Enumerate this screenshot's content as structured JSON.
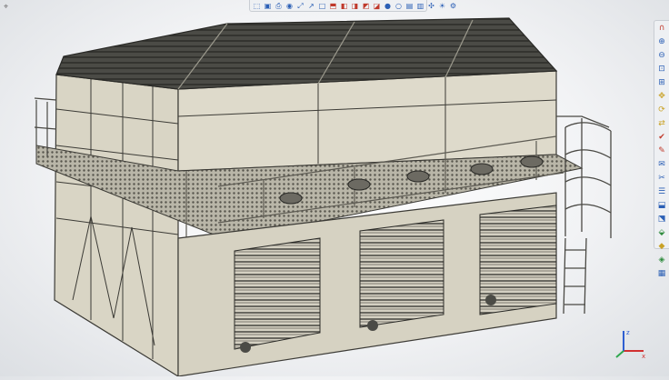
{
  "viewer": {
    "model": "evaporative-cooling-tower-3-cell"
  },
  "top_toolbar": {
    "buttons": [
      {
        "icon": "select-icon",
        "glyph": "⬚"
      },
      {
        "icon": "save-view-icon",
        "glyph": "▣"
      },
      {
        "icon": "print-icon",
        "glyph": "⎙"
      },
      {
        "icon": "camera-icon",
        "glyph": "◉"
      },
      {
        "icon": "fit-view-icon",
        "glyph": "⤢"
      },
      {
        "icon": "measure-icon",
        "glyph": "↗"
      },
      {
        "icon": "box-icon",
        "glyph": "□"
      },
      {
        "icon": "section-icon",
        "glyph": "⬒"
      },
      {
        "icon": "cube-front-icon",
        "glyph": "◧"
      },
      {
        "icon": "cube-top-icon",
        "glyph": "◨"
      },
      {
        "icon": "cube-right-icon",
        "glyph": "◩"
      },
      {
        "icon": "cube-iso-icon",
        "glyph": "◪"
      },
      {
        "icon": "render-shaded-icon",
        "glyph": "●"
      },
      {
        "icon": "render-wire-icon",
        "glyph": "○"
      },
      {
        "icon": "hide-icon",
        "glyph": "▤"
      },
      {
        "icon": "show-icon",
        "glyph": "▥"
      },
      {
        "icon": "explode-icon",
        "glyph": "✣"
      },
      {
        "icon": "light-icon",
        "glyph": "☀"
      },
      {
        "icon": "settings-icon",
        "glyph": "⚙"
      }
    ]
  },
  "right_toolbar": {
    "buttons": [
      {
        "icon": "magnet-icon",
        "glyph": "∩",
        "tone": "red"
      },
      {
        "icon": "zoom-in-icon",
        "glyph": "⊕"
      },
      {
        "icon": "zoom-out-icon",
        "glyph": "⊖"
      },
      {
        "icon": "zoom-window-icon",
        "glyph": "⊡"
      },
      {
        "icon": "zoom-fit-icon",
        "glyph": "⊞"
      },
      {
        "icon": "pan-icon",
        "glyph": "✥",
        "tone": "gold"
      },
      {
        "icon": "rotate-icon",
        "glyph": "⟳",
        "tone": "gold"
      },
      {
        "icon": "walk-icon",
        "glyph": "⇄",
        "tone": "gold"
      },
      {
        "icon": "check-icon",
        "glyph": "✔",
        "tone": "red"
      },
      {
        "icon": "pen-icon",
        "glyph": "✎",
        "tone": "red"
      },
      {
        "icon": "note-icon",
        "glyph": "✉"
      },
      {
        "icon": "cut-icon",
        "glyph": "✂"
      },
      {
        "icon": "layers-icon",
        "glyph": "☰"
      },
      {
        "icon": "view-top-icon",
        "glyph": "⬓"
      },
      {
        "icon": "view-front-icon",
        "glyph": "⬔"
      },
      {
        "icon": "view-iso-icon",
        "glyph": "⬙",
        "tone": "green"
      },
      {
        "icon": "color-icon",
        "glyph": "◆",
        "tone": "gold"
      },
      {
        "icon": "material-icon",
        "glyph": "◈",
        "tone": "green"
      },
      {
        "icon": "properties-icon",
        "glyph": "▦"
      }
    ]
  },
  "axis": {
    "x": "x",
    "y": "y",
    "z": "z",
    "colors": {
      "x": "#d13030",
      "y": "#2fa84f",
      "z": "#2f5fd1"
    }
  }
}
